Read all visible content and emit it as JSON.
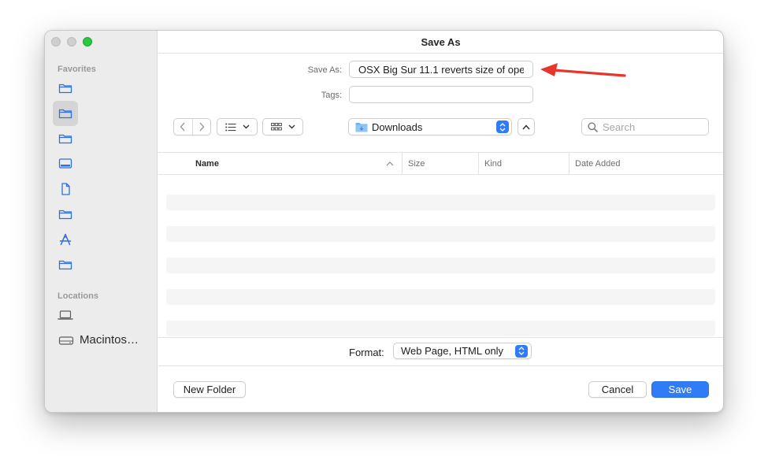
{
  "window": {
    "title": "Save As"
  },
  "sidebar": {
    "favorites_heading": "Favorites",
    "favorites": [
      {
        "icon": "folder-icon",
        "selected": false
      },
      {
        "icon": "folder-icon",
        "selected": true
      },
      {
        "icon": "folder-icon",
        "selected": false
      },
      {
        "icon": "desktop-icon",
        "selected": false
      },
      {
        "icon": "document-icon",
        "selected": false
      },
      {
        "icon": "folder-icon",
        "selected": false
      },
      {
        "icon": "applications-icon",
        "selected": false
      },
      {
        "icon": "folder-icon",
        "selected": false
      }
    ],
    "locations_heading": "Locations",
    "locations": [
      {
        "icon": "laptop-icon",
        "label": ""
      },
      {
        "icon": "hard-drive-icon",
        "label": "Macintos…"
      }
    ]
  },
  "form": {
    "save_as_label": "Save As:",
    "save_as_value": "OSX Big Sur 11.1 reverts size of ope",
    "tags_label": "Tags:",
    "tags_value": ""
  },
  "toolbar": {
    "location": "Downloads",
    "search_placeholder": "Search"
  },
  "columns": [
    "Name",
    "Size",
    "Kind",
    "Date Added"
  ],
  "format": {
    "label": "Format:",
    "value": "Web Page, HTML only"
  },
  "buttons": {
    "new_folder": "New Folder",
    "cancel": "Cancel",
    "save": "Save"
  },
  "colors": {
    "accent": "#2f7cf6",
    "sidebar_icon": "#2f6fe0",
    "annotation_arrow": "#e8352b"
  }
}
